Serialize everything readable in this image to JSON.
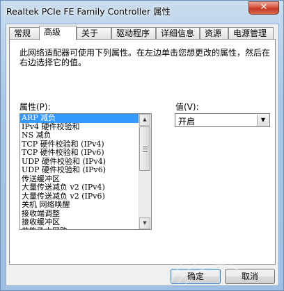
{
  "window": {
    "title": "Realtek PCIe FE Family Controller 属性",
    "close_label": "✕"
  },
  "tabs": [
    {
      "label": "常规",
      "active": false
    },
    {
      "label": "高级",
      "active": true
    },
    {
      "label": "关于",
      "active": false
    },
    {
      "label": "驱动程序",
      "active": false
    },
    {
      "label": "详细信息",
      "active": false
    },
    {
      "label": "资源",
      "active": false
    },
    {
      "label": "电源管理",
      "active": false
    }
  ],
  "panel": {
    "description": "此网络适配器可使用下列属性。在左边单击您想更改的属性，然后在右边选择它的值。",
    "property_label": "属性(P):",
    "value_label": "值(V):",
    "properties": [
      "ARP 减负",
      "IPv4 硬件校验和",
      "NS 减负",
      "TCP 硬件校验和 (IPv4)",
      "TCP 硬件校验和 (IPv6)",
      "UDP 硬件校验和 (IPv4)",
      "UDP 硬件校验和 (IPv6)",
      "传送缓冲区",
      "大量传送减负 v2 (IPv4)",
      "大量传送减负 v2 (IPv6)",
      "关机 网络唤醒",
      "接收端调整",
      "接收缓冲区",
      "节能乙太网路"
    ],
    "selected_index": 0,
    "selected_value": "开启"
  },
  "buttons": {
    "ok": "确定",
    "cancel": "取消"
  },
  "colors": {
    "selection": "#3399ff",
    "frame": "#a9c6e5"
  }
}
